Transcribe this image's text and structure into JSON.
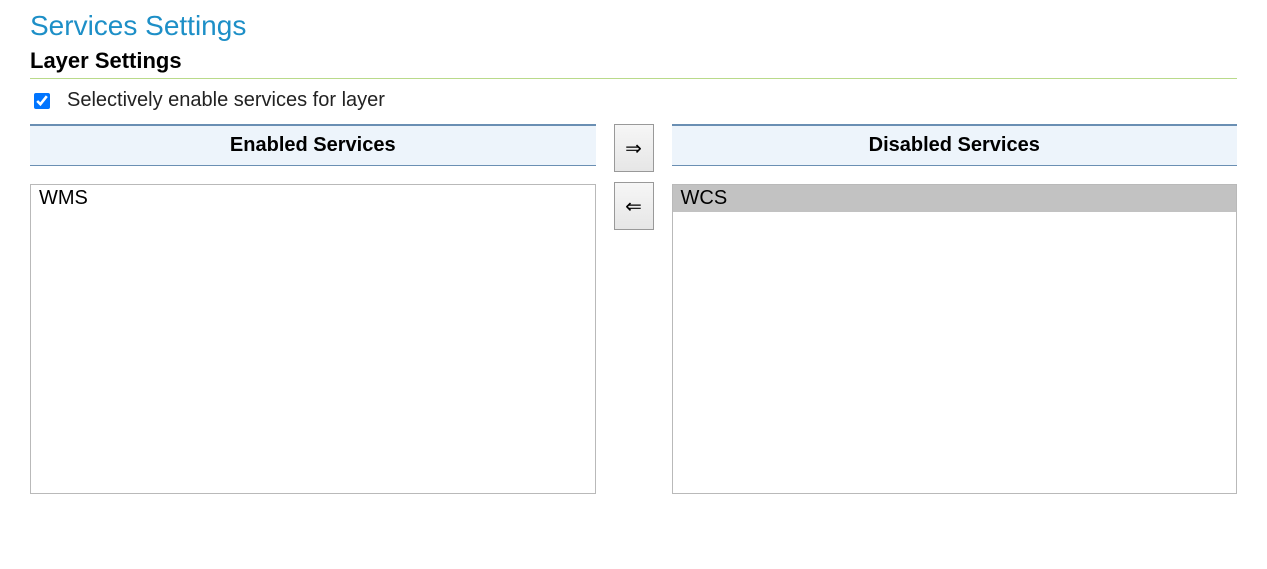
{
  "page_title": "Services Settings",
  "section_title": "Layer Settings",
  "checkbox": {
    "label": "Selectively enable services for layer",
    "checked": true
  },
  "enabled_panel": {
    "header": "Enabled Services",
    "items": [
      {
        "label": "WMS",
        "selected": false
      }
    ]
  },
  "disabled_panel": {
    "header": "Disabled Services",
    "items": [
      {
        "label": "WCS",
        "selected": true
      }
    ]
  },
  "arrows": {
    "right": "⇒",
    "left": "⇐"
  }
}
